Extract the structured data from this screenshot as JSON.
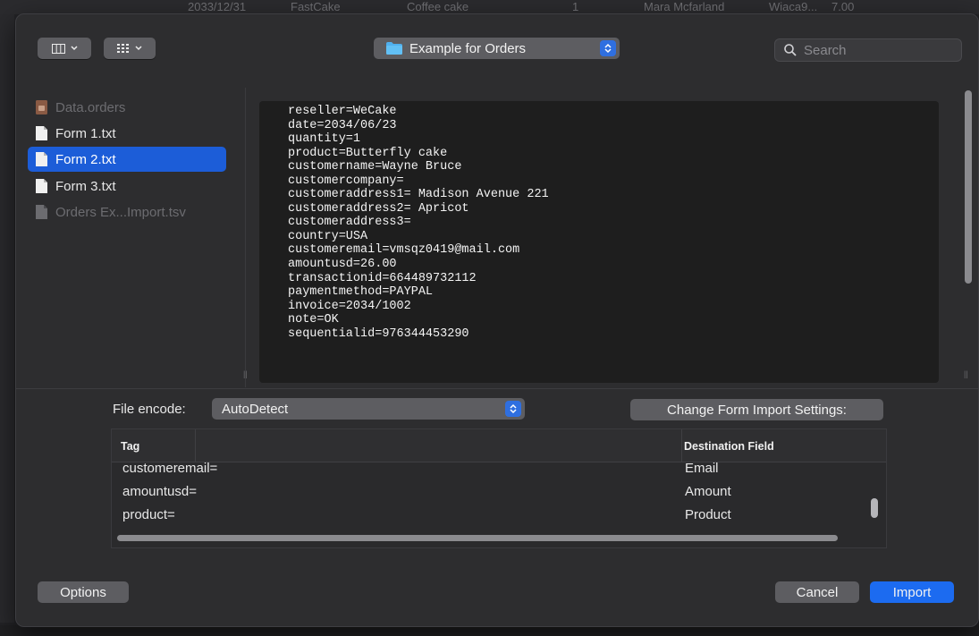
{
  "background": {
    "top_row": [
      "2033/12/31",
      "FastCake",
      "Coffee cake",
      "1",
      "Mara Mcfarland",
      "Wiaca9...",
      "7.00"
    ]
  },
  "toolbar": {
    "column_view_icon": "columns-icon",
    "grid_view_icon": "grid-icon",
    "location": "Example for Orders",
    "search_placeholder": "Search"
  },
  "sidebar": {
    "items": [
      {
        "label": "Data.orders",
        "icon": "database-file-icon",
        "state": "disabled"
      },
      {
        "label": "Form 1.txt",
        "icon": "document-icon",
        "state": "normal"
      },
      {
        "label": "Form 2.txt",
        "icon": "document-icon",
        "state": "selected"
      },
      {
        "label": "Form 3.txt",
        "icon": "document-icon",
        "state": "normal"
      },
      {
        "label": "Orders Ex...Import.tsv",
        "icon": "document-icon",
        "state": "disabled"
      }
    ]
  },
  "preview": {
    "lines": [
      "reseller=WeCake",
      "date=2034/06/23",
      "quantity=1",
      "product=Butterfly cake",
      "customername=Wayne Bruce",
      "customercompany=",
      "customeraddress1= Madison Avenue 221",
      "customeraddress2= Apricot",
      "customeraddress3=",
      "country=USA",
      "customeremail=vmsqz0419@mail.com",
      "amountusd=26.00",
      "transactionid=664489732112",
      "paymentmethod=PAYPAL",
      "invoice=2034/1002",
      "note=OK",
      "sequentialid=976344453290"
    ]
  },
  "settings": {
    "file_encode_label": "File encode:",
    "file_encode_value": "AutoDetect",
    "change_settings_button": "Change Form Import Settings:"
  },
  "mapping_table": {
    "headers": {
      "tag": "Tag",
      "destination": "Destination Field"
    },
    "rows": [
      {
        "tag": "customeremail=",
        "destination": "Email"
      },
      {
        "tag": "amountusd=",
        "destination": "Amount"
      },
      {
        "tag": "product=",
        "destination": "Product"
      }
    ]
  },
  "footer": {
    "options_button": "Options",
    "cancel_button": "Cancel",
    "import_button": "Import"
  },
  "colors": {
    "accent": "#1c6bf0",
    "selection": "#1c5dd8",
    "sheet_bg": "#2d2d2f",
    "preview_bg": "#1e1e1e"
  }
}
